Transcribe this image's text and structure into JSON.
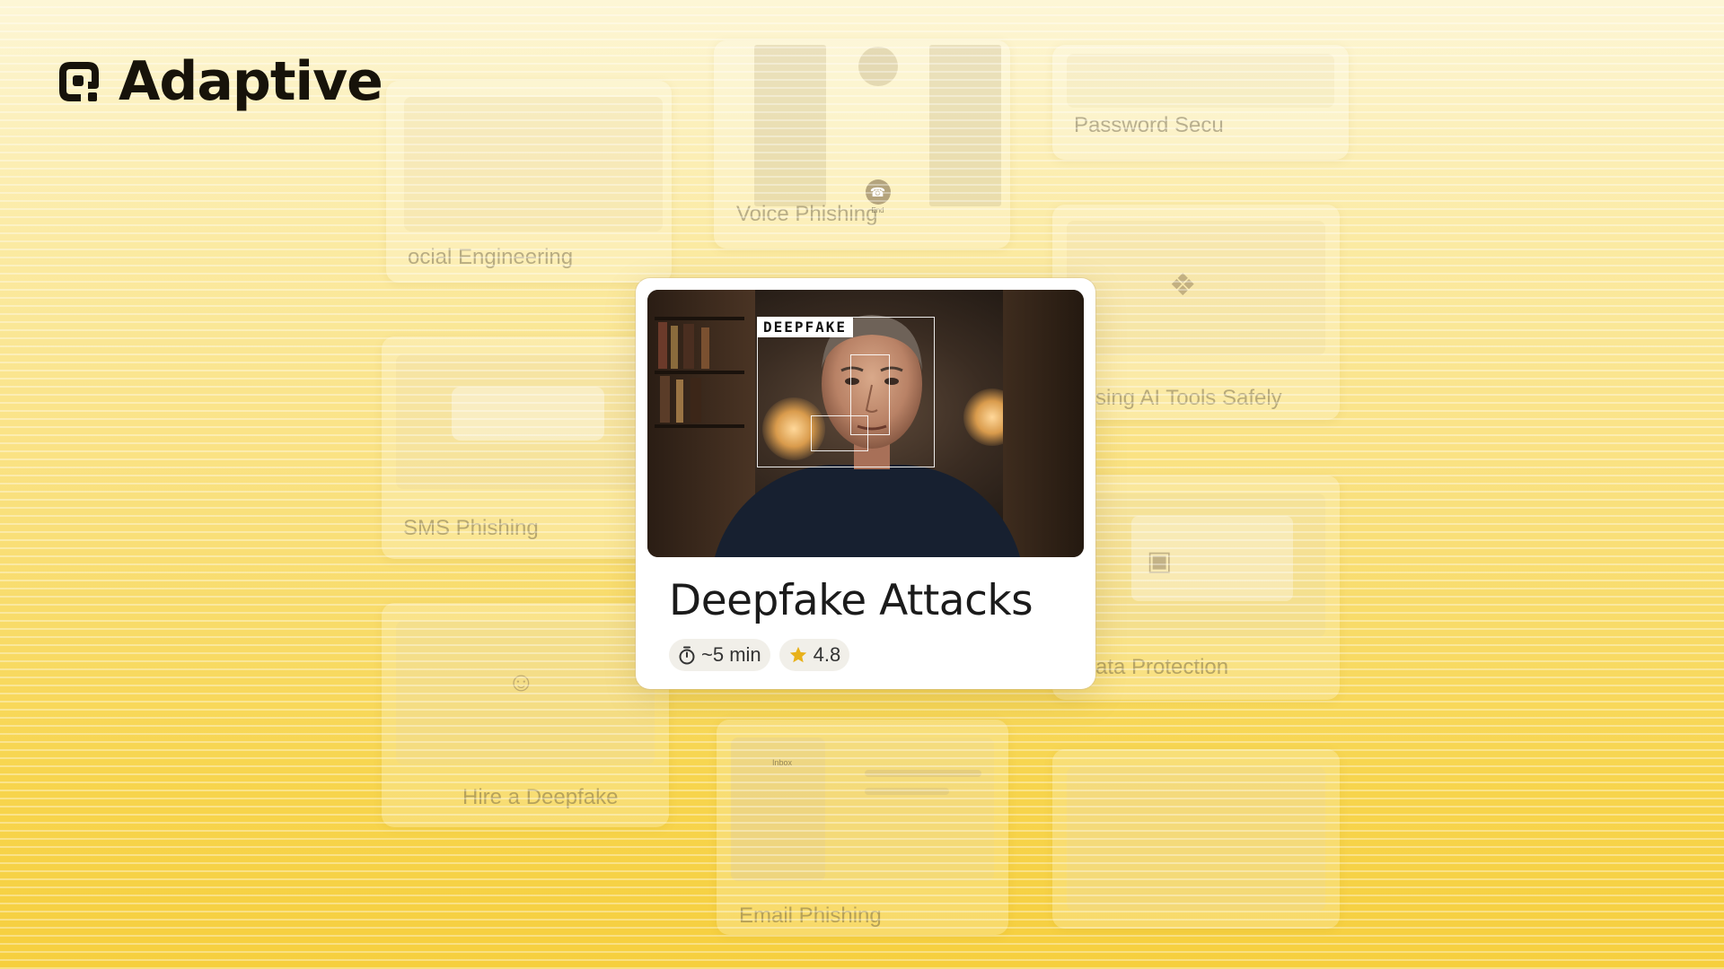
{
  "brand": {
    "name": "Adaptive",
    "logo_icon": "adaptive-logo-icon"
  },
  "background_cards": [
    {
      "id": "voice-phishing",
      "label": "Voice Phishing",
      "call_end_label": "End"
    },
    {
      "id": "password-security",
      "label": "Password Secu"
    },
    {
      "id": "social-engineering",
      "label": "ocial Engineering"
    },
    {
      "id": "ai-tools",
      "label": "sing AI Tools Safely",
      "icon": "brain-icon"
    },
    {
      "id": "sms-phishing",
      "label": "SMS Phishing"
    },
    {
      "id": "data-protection",
      "label": "ata Protection",
      "icon": "lock-icon"
    },
    {
      "id": "hire-deepfake",
      "label": "Hire a Deepfake",
      "icon": "user-icon"
    },
    {
      "id": "email-phishing",
      "label": "Email Phishing",
      "inbox_label": "Inbox"
    }
  ],
  "featured": {
    "title": "Deepfake Attacks",
    "badge": "DEEPFAKE",
    "duration": "~5 min",
    "rating": "4.8",
    "colors": {
      "accent_star": "#e8b11a",
      "chip_bg": "#f1efe9"
    }
  }
}
